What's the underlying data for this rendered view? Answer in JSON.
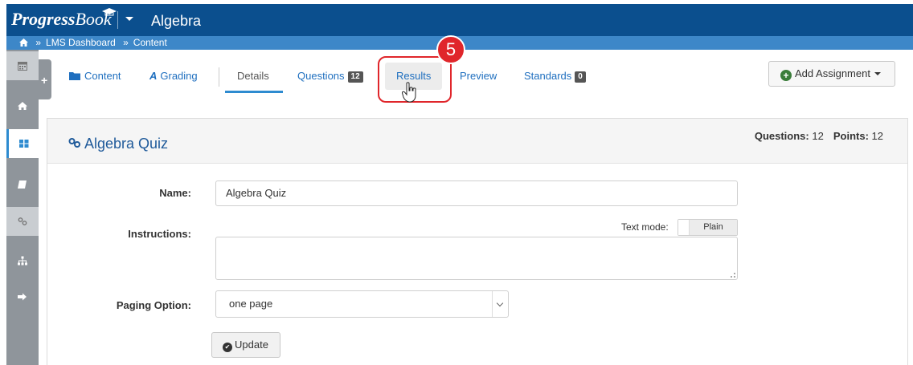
{
  "app": {
    "logo_part1": "Progress",
    "logo_part2": "Book",
    "title": "Algebra"
  },
  "breadcrumb": {
    "sep1": "»",
    "item1": "LMS Dashboard",
    "sep2": "»",
    "item2": "Content"
  },
  "sidebar": {
    "items": [
      "calendar-icon",
      "home-icon",
      "dashboard-icon",
      "book-icon",
      "link-icon",
      "sitemap-icon",
      "sign-out-icon"
    ]
  },
  "tabs": {
    "content": "Content",
    "grading_icon": "A",
    "grading": "Grading",
    "details": "Details",
    "questions": "Questions",
    "questions_count": "12",
    "results": "Results",
    "preview": "Preview",
    "standards": "Standards",
    "standards_count": "0"
  },
  "annotation": {
    "step": "5"
  },
  "actions": {
    "add_assignment": "Add Assignment"
  },
  "panel": {
    "title": "Algebra Quiz",
    "questions_label": "Questions:",
    "questions_value": "12",
    "points_label": "Points:",
    "points_value": "12"
  },
  "form": {
    "name_label": "Name:",
    "name_value": "Algebra Quiz",
    "instructions_label": "Instructions:",
    "text_mode_label": "Text mode:",
    "text_mode_value": "Plain",
    "paging_label": "Paging Option:",
    "paging_value": "one page",
    "update_label": "Update"
  },
  "colors": {
    "topbar": "#0b4f8e",
    "breadcrumb": "#3d87c8",
    "link": "#1f6fbf",
    "highlight": "#e0262b"
  }
}
